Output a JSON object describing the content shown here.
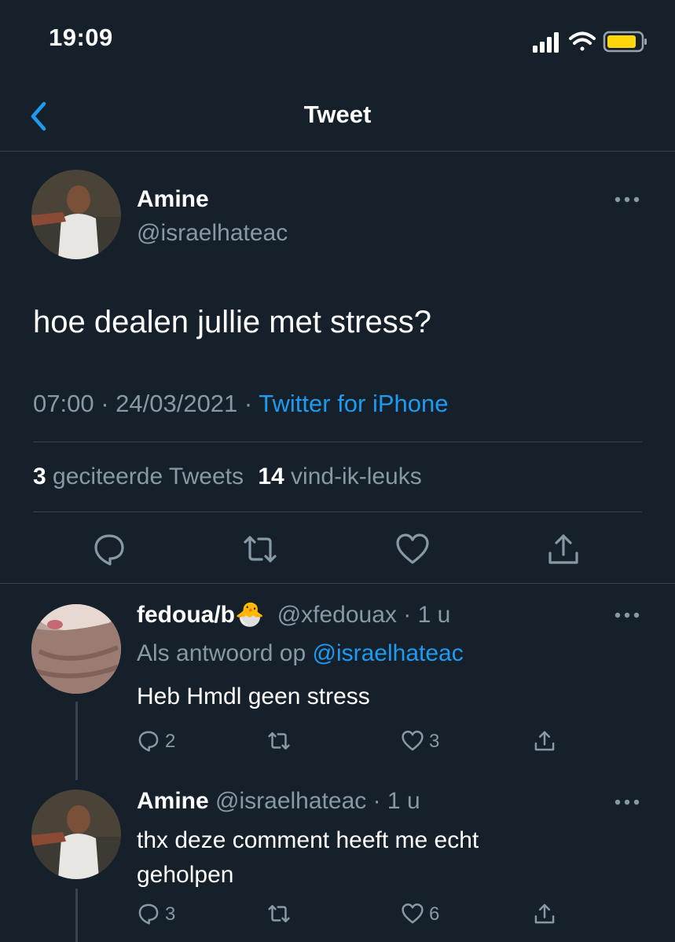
{
  "status_bar": {
    "time": "19:09",
    "battery_color": "#ffd60a"
  },
  "nav": {
    "title": "Tweet",
    "back_icon": "chevron-left-icon"
  },
  "tweet": {
    "display_name": "Amine",
    "handle": "@israelhateac",
    "text": "hoe dealen jullie met stress?",
    "time": "07:00",
    "date": "24/03/2021",
    "source": "Twitter for iPhone",
    "quote_count": "3",
    "quote_label": "geciteerde Tweets",
    "like_count": "14",
    "like_label": "vind-ik-leuks"
  },
  "replies": [
    {
      "display_name": "fedoua/b",
      "emoji": "🐣",
      "handle": "@xfedouax",
      "age": "1 u",
      "reply_to_prefix": "Als antwoord op",
      "reply_to_handle": "@israelhateac",
      "text": "Heb Hmdl geen stress",
      "reply_count": "2",
      "retweet_count": "",
      "like_count": "3"
    },
    {
      "display_name": "Amine",
      "handle": "@israelhateac",
      "age": "1 u",
      "text_line1": "thx deze comment heeft me echt",
      "text_line2": "geholpen",
      "reply_count": "3",
      "retweet_count": "",
      "like_count": "6"
    }
  ],
  "colors": {
    "background": "#15202b",
    "accent": "#1d9bf0",
    "muted": "#8899a6",
    "divider": "#38444d"
  }
}
